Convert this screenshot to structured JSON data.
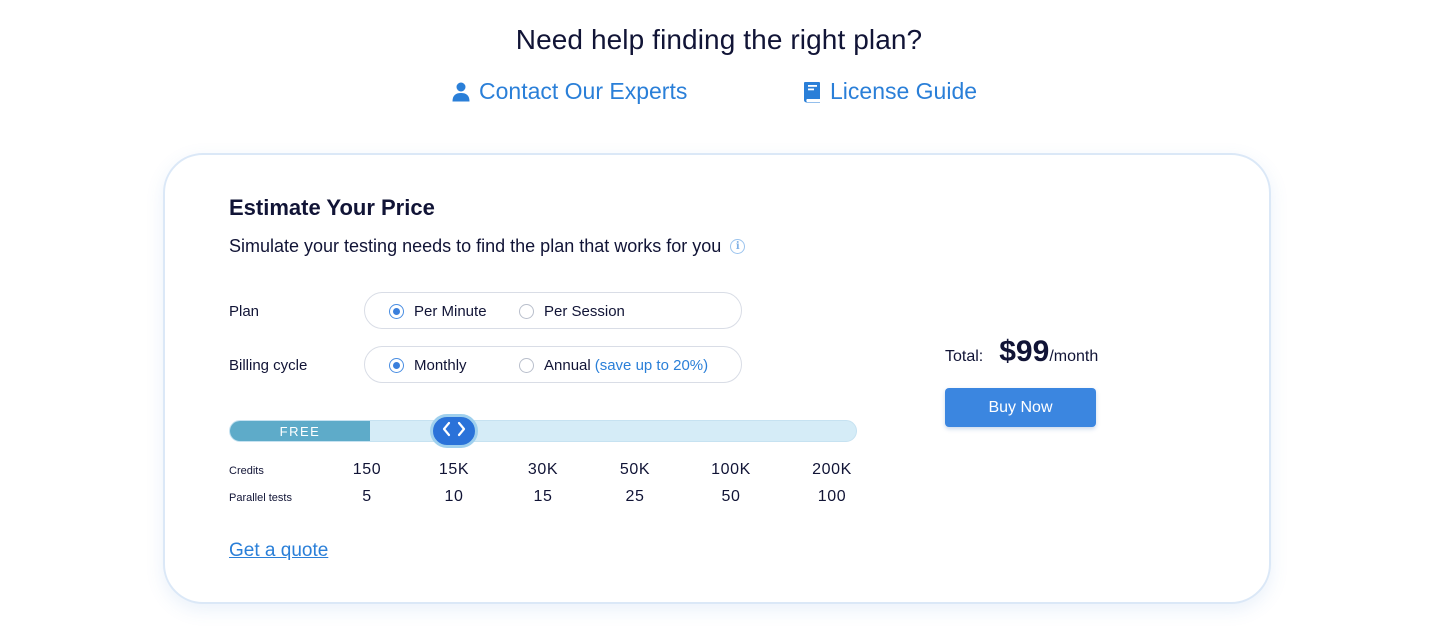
{
  "help": {
    "title": "Need help finding the right plan?",
    "contact_label": "Contact Our Experts",
    "license_label": "License Guide"
  },
  "estimator": {
    "title": "Estimate Your Price",
    "subtitle": "Simulate your testing needs to find the plan that works for you",
    "plan": {
      "label": "Plan",
      "options": [
        {
          "label": "Per Minute",
          "selected": true
        },
        {
          "label": "Per Session",
          "selected": false
        }
      ]
    },
    "billing": {
      "label": "Billing cycle",
      "options": [
        {
          "label": "Monthly",
          "selected": true
        },
        {
          "label": "Annual",
          "selected": false
        }
      ],
      "save_note": "(save up to 20%)"
    },
    "slider": {
      "free_label": "FREE",
      "selected_index": 1,
      "credits_label": "Credits",
      "parallel_label": "Parallel tests",
      "credits": [
        "150",
        "15K",
        "30K",
        "50K",
        "100K",
        "200K"
      ],
      "parallel": [
        "5",
        "10",
        "15",
        "25",
        "50",
        "100"
      ]
    },
    "quote_label": "Get a quote"
  },
  "pricing": {
    "total_label": "Total:",
    "amount": "$99",
    "period": "/month",
    "buy_label": "Buy Now"
  },
  "colors": {
    "accent": "#3b86e0",
    "link": "#2a7fd8",
    "text": "#111436",
    "free_segment": "#5eabc9",
    "track": "#d5ecf7"
  }
}
